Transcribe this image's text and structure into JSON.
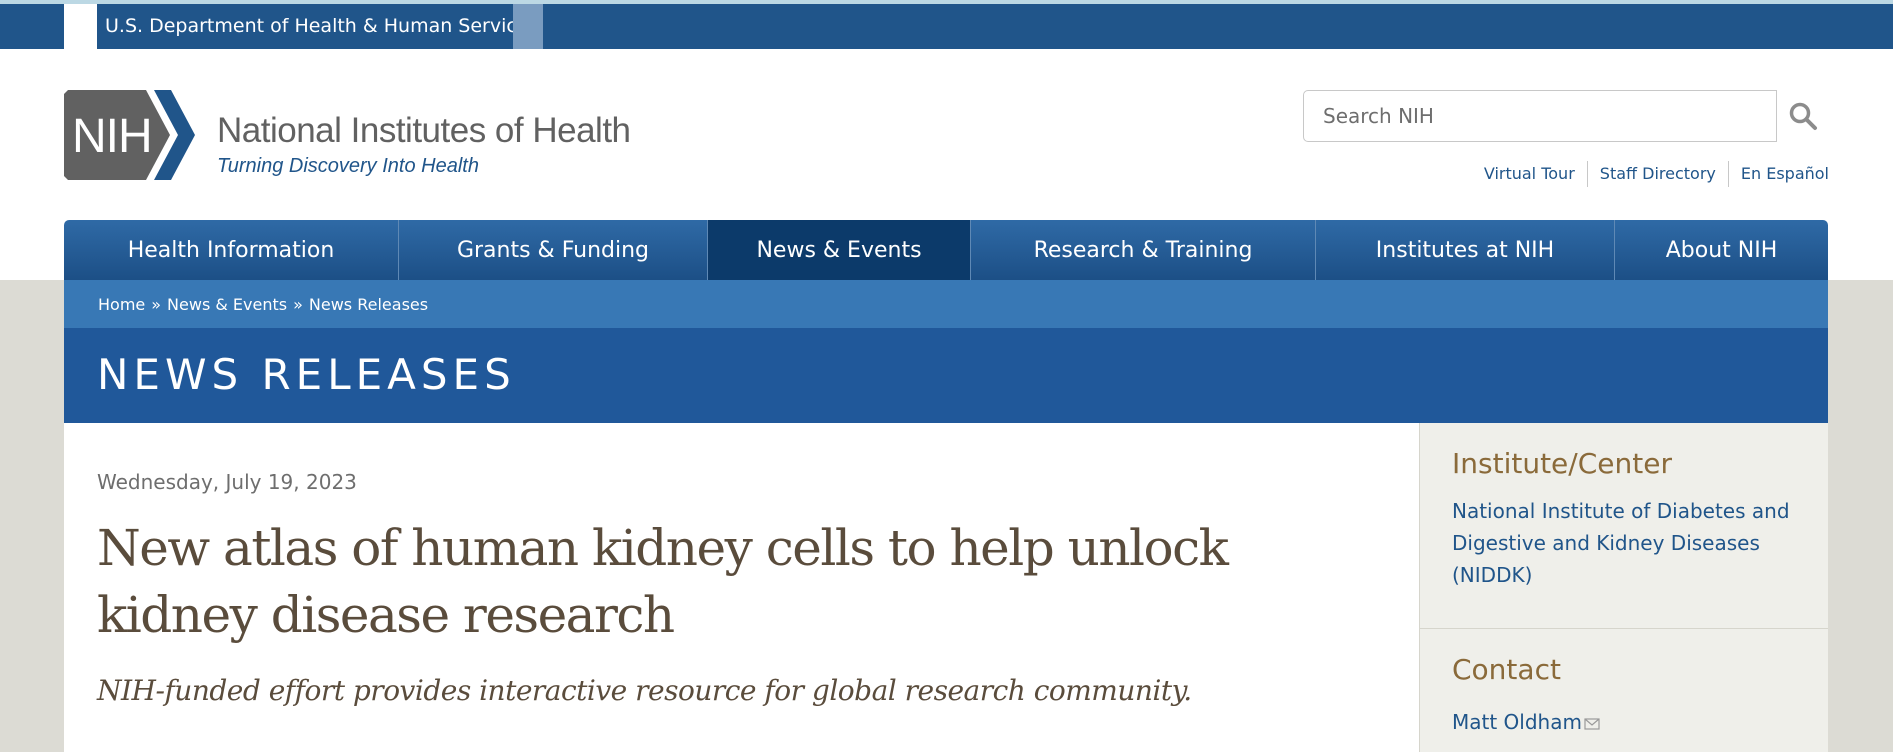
{
  "hhs_bar": {
    "label": "U.S. Department of Health & Human Services"
  },
  "header": {
    "logo_mark": "NIH",
    "logo_title": "National Institutes of Health",
    "logo_tagline": "Turning Discovery Into Health",
    "search_placeholder": "Search NIH",
    "utility_links": [
      "Virtual Tour",
      "Staff Directory",
      "En Español"
    ]
  },
  "nav": {
    "items": [
      {
        "label": "Health Information"
      },
      {
        "label": "Grants & Funding"
      },
      {
        "label": "News & Events",
        "active": true
      },
      {
        "label": "Research & Training"
      },
      {
        "label": "Institutes at NIH"
      },
      {
        "label": "About NIH"
      }
    ]
  },
  "breadcrumb": {
    "items": [
      "Home",
      "News & Events",
      "News Releases"
    ],
    "separator": "»"
  },
  "page": {
    "title": "NEWS RELEASES"
  },
  "article": {
    "date": "Wednesday, July 19, 2023",
    "headline": "New atlas of human kidney cells to help unlock kidney disease research",
    "subhead": "NIH-funded effort provides interactive resource for global research community."
  },
  "sidebar": {
    "institute_heading": "Institute/Center",
    "institute_link": "National Institute of Diabetes and Digestive and Kidney Diseases (NIDDK)",
    "contact_heading": "Contact",
    "contact_name": "Matt Oldham"
  },
  "colors": {
    "primary": "#20558a",
    "nav_active": "#0c3a6a",
    "breadcrumb": "#3878b5",
    "headline": "#5a4c3c",
    "sidebar_heading": "#8a6a3a"
  }
}
